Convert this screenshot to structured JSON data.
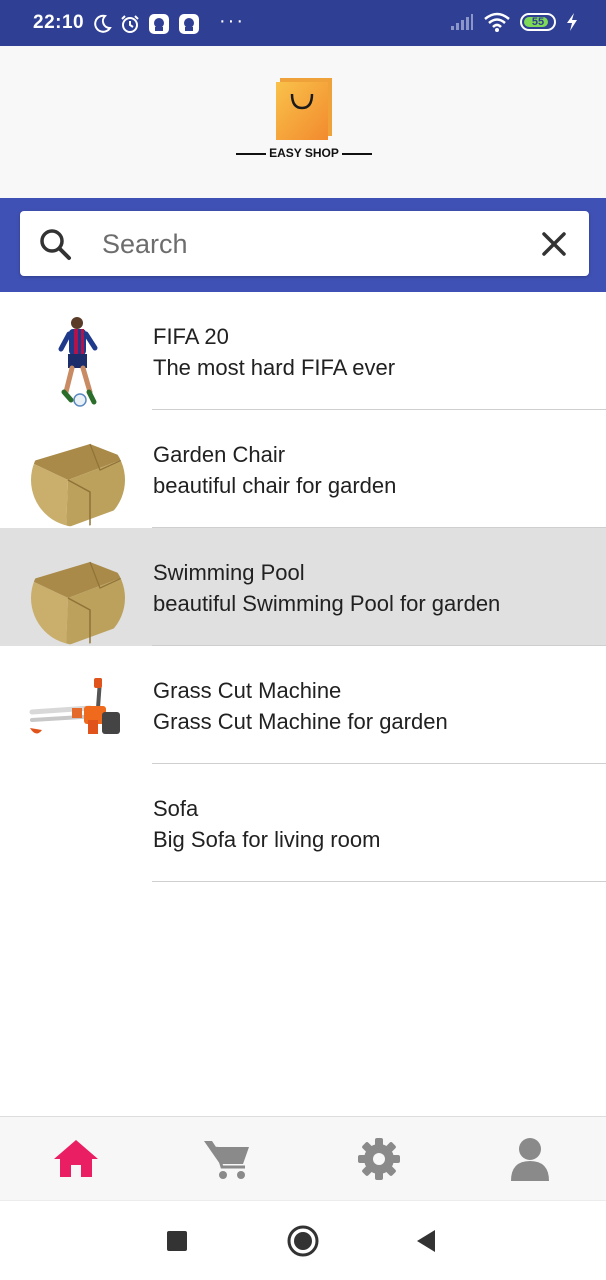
{
  "status_bar": {
    "time": "22:10",
    "icons": [
      "moon-icon",
      "alarm-icon",
      "app-notification-icon",
      "app-notification-icon",
      "more-dots-icon"
    ],
    "more": "···",
    "signal": "signal-icon",
    "wifi": "wifi-icon",
    "battery_level": "55",
    "charging": "charging-bolt-icon"
  },
  "header": {
    "logo_text": "EASY SHOP",
    "logo_color": "#f7a034"
  },
  "search": {
    "placeholder": "Search",
    "value": "",
    "search_icon": "search-icon",
    "clear_icon": "close-icon"
  },
  "products": [
    {
      "title": "FIFA 20",
      "description": "The most hard FIFA ever",
      "thumbnail": "soccer-player-image",
      "selected": false
    },
    {
      "title": "Garden Chair",
      "description": "beautiful chair for garden",
      "thumbnail": "cardboard-box-image",
      "selected": false
    },
    {
      "title": "Swimming Pool",
      "description": "beautiful Swimming Pool for garden",
      "thumbnail": "cardboard-box-image",
      "selected": true
    },
    {
      "title": "Grass Cut Machine",
      "description": "Grass Cut Machine for garden",
      "thumbnail": "grass-cutter-image",
      "selected": false
    },
    {
      "title": "Sofa",
      "description": "Big Sofa for living room",
      "thumbnail": "",
      "selected": false
    }
  ],
  "bottom_nav": [
    {
      "icon": "home-icon",
      "active": true
    },
    {
      "icon": "cart-icon",
      "active": false
    },
    {
      "icon": "settings-icon",
      "active": false
    },
    {
      "icon": "profile-icon",
      "active": false
    }
  ],
  "colors": {
    "status_bar": "#2f3f94",
    "search_band": "#3f51b5",
    "nav_active": "#e91e63",
    "nav_inactive": "#8a8a8a",
    "selected_row": "#e0e0e0"
  },
  "system_nav": [
    "recents-icon",
    "home-circle-icon",
    "back-icon"
  ]
}
